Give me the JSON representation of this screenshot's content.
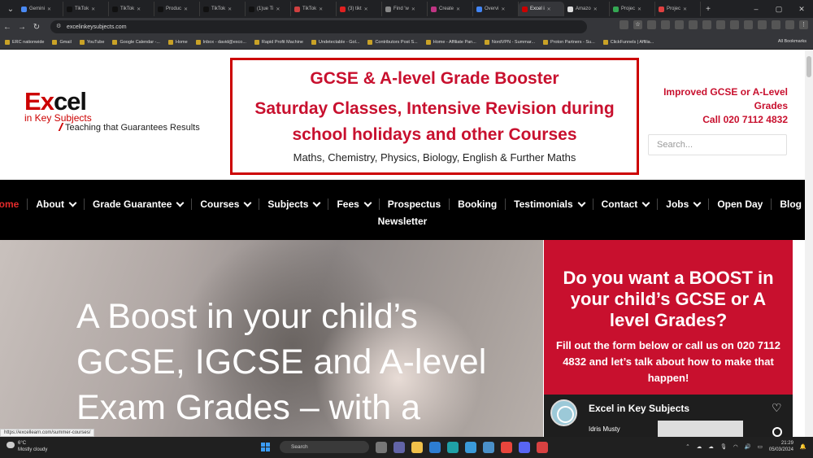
{
  "browser": {
    "tabs": [
      {
        "label": "Gemini",
        "color": "#4a8af4"
      },
      {
        "label": "TikTok",
        "color": "#111"
      },
      {
        "label": "TikTok",
        "color": "#111"
      },
      {
        "label": "Produc",
        "color": "#111"
      },
      {
        "label": "TikTok",
        "color": "#111"
      },
      {
        "label": "(1)ue Ti",
        "color": "#111"
      },
      {
        "label": "TikTok",
        "color": "#d04040"
      },
      {
        "label": "(3) tikt",
        "color": "#e02020"
      },
      {
        "label": "Find 'w",
        "color": "#888"
      },
      {
        "label": "Create",
        "color": "#c13584"
      },
      {
        "label": "Overvi",
        "color": "#4285f4"
      },
      {
        "label": "Excel i",
        "color": "#c00"
      },
      {
        "label": "Amazo",
        "color": "#ddd"
      },
      {
        "label": "Projec",
        "color": "#34a853"
      },
      {
        "label": "Projec",
        "color": "#e04040"
      }
    ],
    "active_tab": 11,
    "url": "excelinkeysubjects.com",
    "bookmarks": [
      "ERC nationwide",
      "Gmail",
      "YouTube",
      "Google Calendar -...",
      "Home",
      "Inbox - david@exco...",
      "Rapid Profit Machine",
      "Undetectable - Gol...",
      "Contributors Post S...",
      "Home - Affiliate Pan...",
      "NordVPN - Summar...",
      "Proton Partners - Su...",
      "ClickFunnels | Affilia..."
    ],
    "bookmarks_right": "All Bookmarks"
  },
  "site": {
    "logo": {
      "e": "E",
      "x": "x",
      "cel": "cel",
      "sub": "in Key Subjects",
      "tagline": "Teaching that Guarantees Results"
    },
    "promo": {
      "line1": "GCSE & A-level Grade Booster",
      "line2": "Saturday Classes, Intensive Revision during school holidays and other Courses",
      "line3": "Maths, Chemistry, Physics, Biology, English & Further Maths"
    },
    "contact": {
      "line1": "Improved GCSE or A-Level Grades",
      "line2": "Call 020 7112 4832"
    },
    "search_placeholder": "Search...",
    "menu": [
      {
        "label": "Home",
        "chevron": false
      },
      {
        "label": "About",
        "chevron": true
      },
      {
        "label": "Grade Guarantee",
        "chevron": true
      },
      {
        "label": "Courses",
        "chevron": true
      },
      {
        "label": "Subjects",
        "chevron": true
      },
      {
        "label": "Fees",
        "chevron": true
      },
      {
        "label": "Prospectus",
        "chevron": false
      },
      {
        "label": "Booking",
        "chevron": false
      },
      {
        "label": "Testimonials",
        "chevron": true
      },
      {
        "label": "Contact",
        "chevron": true
      },
      {
        "label": "Jobs",
        "chevron": true
      },
      {
        "label": "Open Day",
        "chevron": false
      },
      {
        "label": "Blog",
        "chevron": true
      }
    ],
    "menu_row2": "Newsletter",
    "hero_text": "A Boost in your child’s GCSE, IGCSE and A-level Exam Grades – with a",
    "form": {
      "title": "Do you want a BOOST in your child’s GCSE or A level Grades?",
      "text": "Fill out the form below or call us on 020 7112 4832 and let’s talk about how to make that happen!"
    },
    "fb": {
      "name": "Excel in Key Subjects",
      "sub": "Idris Musty"
    }
  },
  "status_url": "https://excellearn.com/summer-courses/",
  "taskbar": {
    "temp": "6°C",
    "weather": "Mostly cloudy",
    "search": "Search",
    "time": "21:29",
    "date": "05/03/2024"
  }
}
